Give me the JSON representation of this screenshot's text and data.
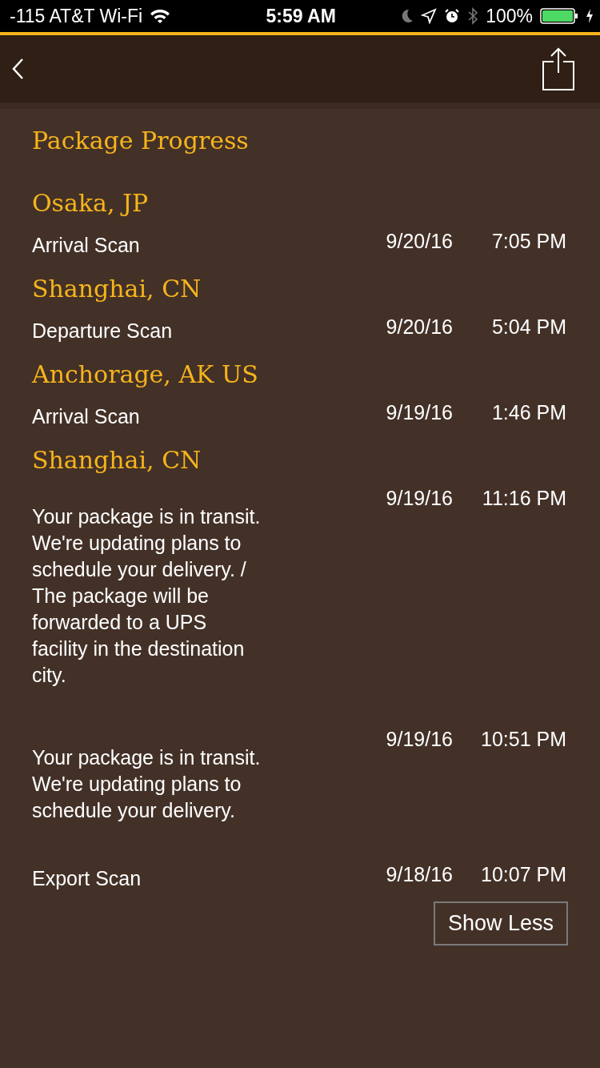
{
  "status_bar": {
    "carrier": "-115 AT&T Wi-Fi",
    "time": "5:59 AM",
    "battery": "100%"
  },
  "title": "Package Progress",
  "locations": [
    {
      "name": "Osaka, JP",
      "events": [
        {
          "kind": "scan",
          "description": "Arrival Scan",
          "date": "9/20/16",
          "time": "7:05 PM"
        }
      ]
    },
    {
      "name": "Shanghai, CN",
      "events": [
        {
          "kind": "scan",
          "description": "Departure Scan",
          "date": "9/20/16",
          "time": "5:04 PM"
        }
      ]
    },
    {
      "name": "Anchorage, AK US",
      "events": [
        {
          "kind": "scan",
          "description": "Arrival Scan",
          "date": "9/19/16",
          "time": "1:46 PM"
        }
      ]
    },
    {
      "name": "Shanghai, CN",
      "events": [
        {
          "kind": "note",
          "description": "Your package is in transit. We're updating plans to schedule your delivery.  / The package will be forwarded to a UPS facility in the destination city.",
          "date": "9/19/16",
          "time": "11:16 PM"
        },
        {
          "kind": "note",
          "description": "Your package is in transit. We're updating plans to schedule your delivery.",
          "date": "9/19/16",
          "time": "10:51 PM"
        },
        {
          "kind": "scan",
          "description": "Export Scan",
          "date": "9/18/16",
          "time": "10:07 PM"
        }
      ]
    }
  ],
  "button": "Show Less"
}
